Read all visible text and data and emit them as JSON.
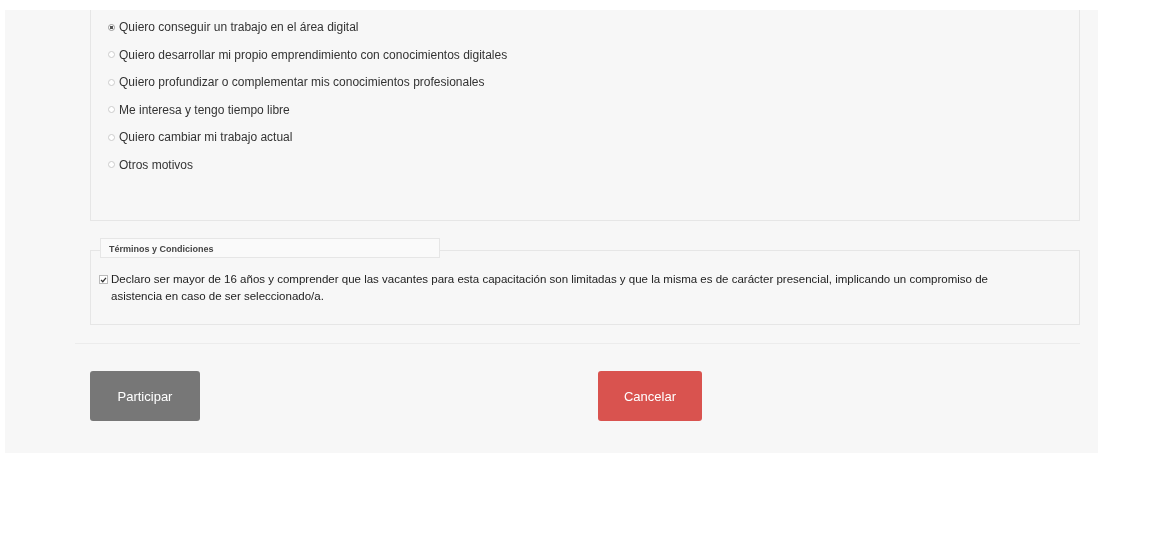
{
  "reasons": [
    {
      "label": "Quiero conseguir un trabajo en el área digital",
      "selected": true
    },
    {
      "label": "Quiero desarrollar mi propio emprendimiento con conocimientos digitales",
      "selected": false
    },
    {
      "label": "Quiero profundizar o complementar mis conocimientos profesionales",
      "selected": false
    },
    {
      "label": "Me interesa y tengo tiempo libre",
      "selected": false
    },
    {
      "label": "Quiero cambiar mi trabajo actual",
      "selected": false
    },
    {
      "label": "Otros motivos",
      "selected": false
    }
  ],
  "terms": {
    "legend": "Términos y Condiciones",
    "checked": true,
    "text": "Declaro ser mayor de 16 años y comprender que las vacantes para esta capacitación son limitadas y que la misma es de carácter presencial, implicando un compromiso de asistencia en caso de ser seleccionado/a."
  },
  "buttons": [
    {
      "label": "Participar",
      "kind": "primary"
    },
    {
      "label": "Cancelar",
      "kind": "danger"
    }
  ]
}
